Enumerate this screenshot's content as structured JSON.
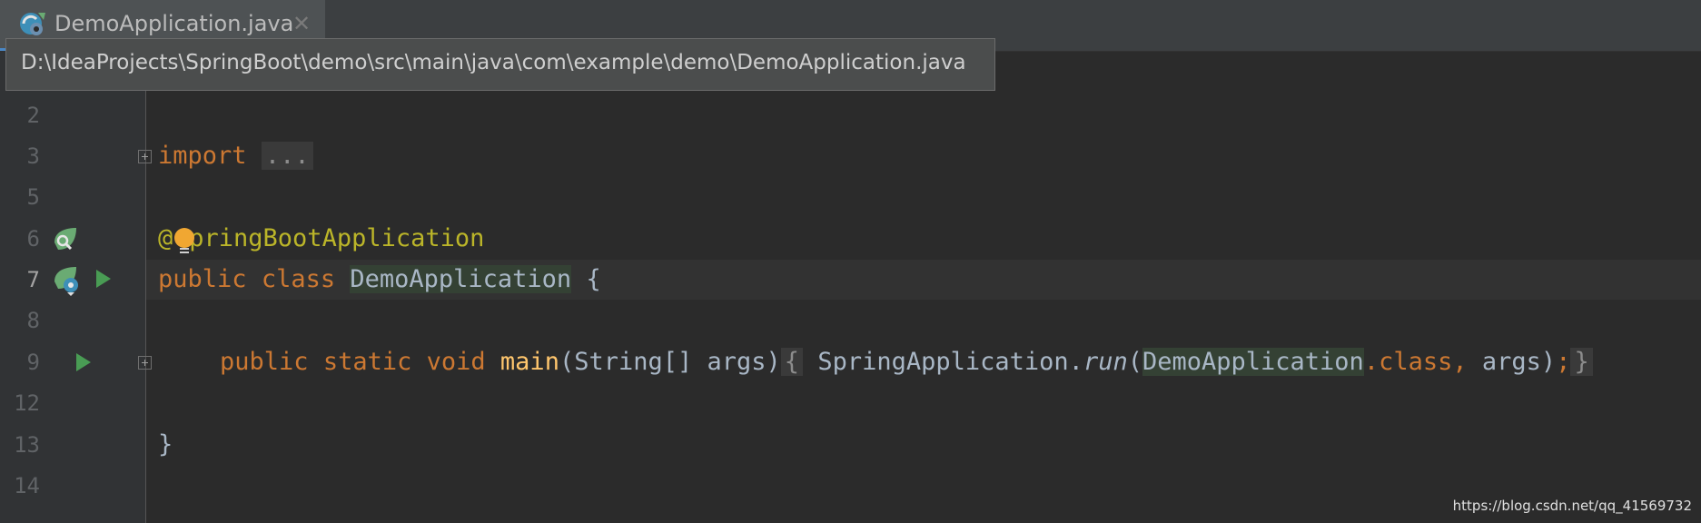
{
  "tab": {
    "title": "DemoApplication.java",
    "close_glyph": "✕",
    "icon": "spring-class-icon"
  },
  "tooltip": {
    "path": "D:\\IdeaProjects\\SpringBoot\\demo\\src\\main\\java\\com\\example\\demo\\DemoApplication.java"
  },
  "gutter": {
    "line_numbers": [
      "2",
      "3",
      "5",
      "6",
      "7",
      "8",
      "9",
      "12",
      "13",
      "14"
    ],
    "current_line": "7"
  },
  "code": {
    "import_kw": "import",
    "import_fold": "...",
    "annotation_at": "@",
    "annotation_rest": "pringBootApplication",
    "public": "public",
    "class": "class",
    "class_name": "DemoApplication",
    "open_brace": "{",
    "static": "static",
    "void": "void",
    "main": "main",
    "params_prefix": "(String[] args)",
    "fold_open": "{",
    "spring_app": "SpringApplication.",
    "run": "run",
    "paren_open": "(",
    "arg_class": "DemoApplication",
    "dot_class": ".class",
    "comma": ", ",
    "args": "args",
    "paren_close": ")",
    "semicolon": ";",
    "fold_close": "}",
    "close_brace": "}"
  },
  "watermark": "https://blog.csdn.net/qq_41569732",
  "colors": {
    "background": "#2b2b2b",
    "keyword": "#cc7832",
    "annotation": "#bbb529",
    "method": "#ffc66d",
    "run_arrow": "#499c54"
  }
}
